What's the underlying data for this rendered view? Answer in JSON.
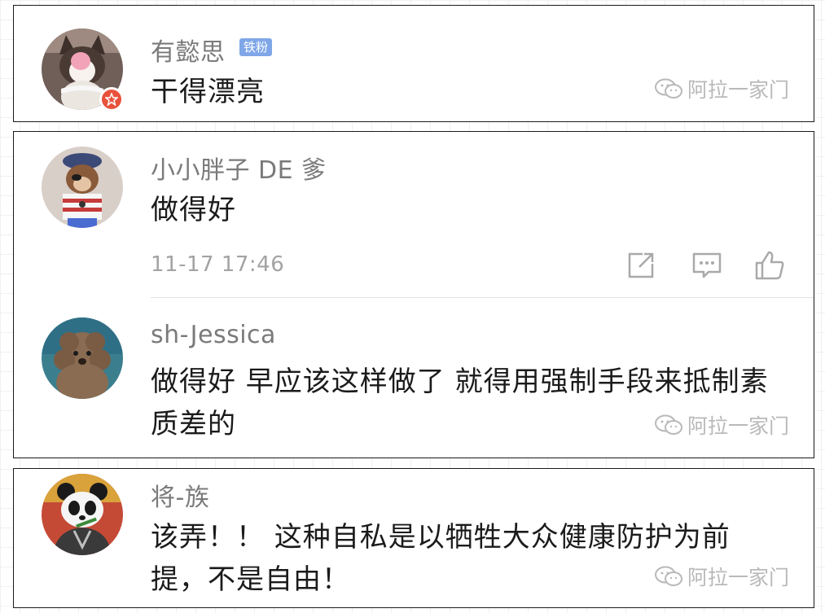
{
  "watermark": "阿拉一家门",
  "comments": [
    {
      "username": "有懿思",
      "badge": "铁粉",
      "text": "干得漂亮",
      "avatar_icon": "cat-avatar",
      "vip_icon": "star-icon"
    },
    {
      "username": "小小胖子 DE 爹",
      "text": "做得好",
      "time": "11-17 17:46",
      "avatar_icon": "pirate-monkey-avatar",
      "actions": [
        "share-icon",
        "comment-icon",
        "like-icon"
      ],
      "reply": {
        "username": "sh-Jessica",
        "text_line1": "做得好 早应该这样做了 就得用强制手段来抵制素",
        "text_line2": "质差的",
        "avatar_icon": "poodle-avatar"
      }
    },
    {
      "username": "将-族",
      "text_line1": "该弄！！ 这种自私是以牺牲大众健康防护为前",
      "text_line2": "提，不是自由！",
      "avatar_icon": "panda-avatar"
    }
  ],
  "colors": {
    "username": "#7a7a7a",
    "comment_text": "#1b1b1b",
    "badge_bg": "#7fa7e8",
    "vip_badge": "#e8523b",
    "timestamp": "#a3a3a3",
    "watermark": "#b9b9b9"
  }
}
